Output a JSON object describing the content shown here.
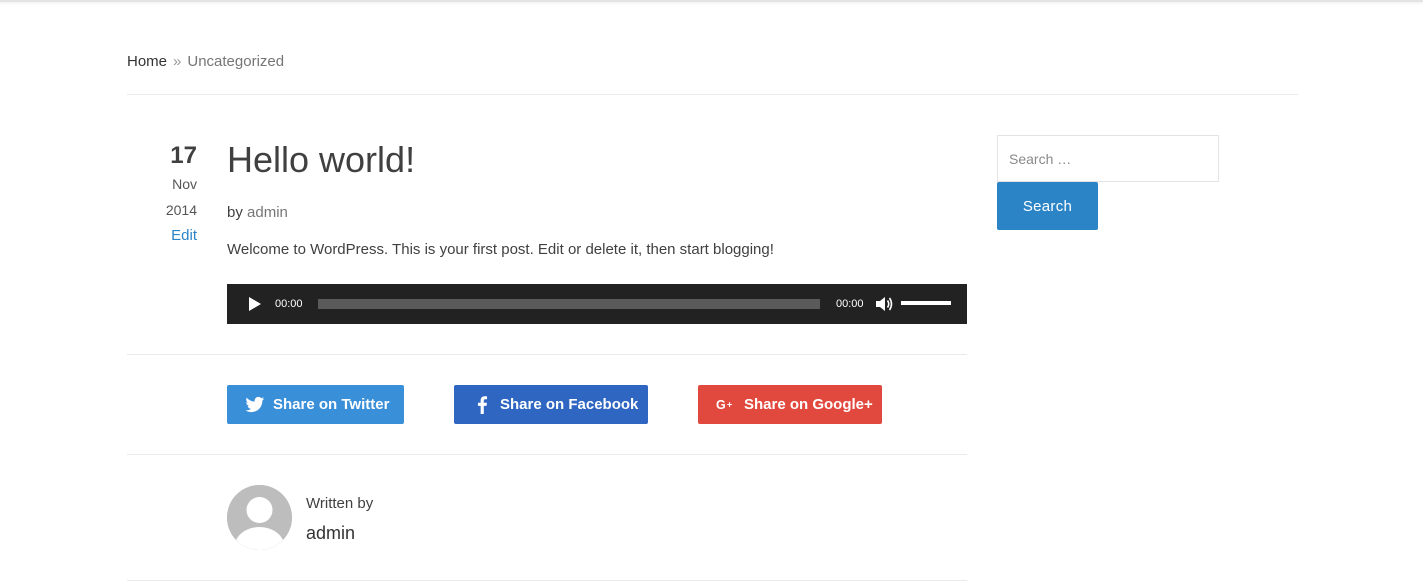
{
  "breadcrumb": {
    "home": "Home",
    "separator": "»",
    "current": "Uncategorized"
  },
  "post": {
    "day": "17",
    "month": "Nov",
    "year": "2014",
    "edit_label": "Edit",
    "title": "Hello world!",
    "by_label": "by",
    "author": "admin",
    "content": "Welcome to WordPress. This is your first post. Edit or delete it, then start blogging!"
  },
  "audio_player": {
    "current_time": "00:00",
    "duration": "00:00",
    "play_icon": "play-icon",
    "volume_icon": "volume-icon",
    "progress": 0,
    "volume": 1
  },
  "share": {
    "twitter": {
      "label": "Share on Twitter",
      "icon": "twitter-icon",
      "color": "#3a8fd9"
    },
    "facebook": {
      "label": "Share on Facebook",
      "icon": "facebook-icon",
      "color": "#2f66c2"
    },
    "google": {
      "label": "Share on Google+",
      "icon": "google-plus-icon",
      "color": "#e1493f"
    }
  },
  "author_box": {
    "written_by": "Written by",
    "name": "admin",
    "avatar_icon": "avatar-icon"
  },
  "sidebar": {
    "search_placeholder": "Search …",
    "search_button": "Search"
  },
  "colors": {
    "accent": "#2b84c6",
    "player_bg": "#222222"
  }
}
